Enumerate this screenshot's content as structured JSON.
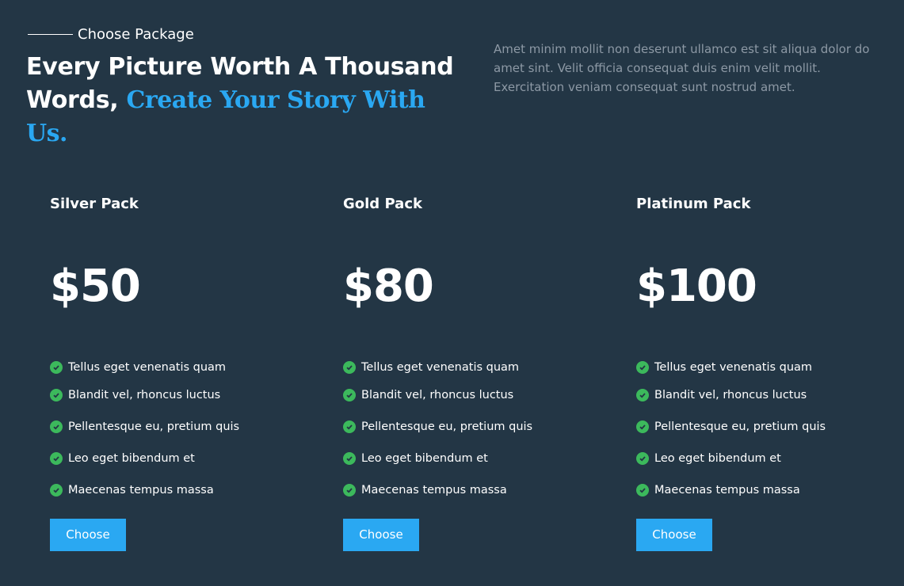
{
  "header": {
    "eyebrow": "Choose Package",
    "headline_plain": "Every Picture Worth A Thousand Words,",
    "headline_accent": "Create Your Story With Us.",
    "intro": "Amet minim mollit non deserunt ullamco est sit aliqua dolor do amet sint. Velit officia consequat duis enim velit mollit. Exercitation veniam consequat sunt nostrud amet."
  },
  "colors": {
    "background": "#233645",
    "accent": "#2aa8f2",
    "check": "#3cb95c",
    "muted_text": "#8d99a5"
  },
  "packages": [
    {
      "name": "Silver Pack",
      "price": "$50",
      "features": [
        "Tellus eget venenatis quam",
        "Blandit vel, rhoncus luctus",
        "Pellentesque eu, pretium quis",
        "Leo eget bibendum et",
        "Maecenas tempus massa"
      ],
      "button": "Choose"
    },
    {
      "name": "Gold Pack",
      "price": "$80",
      "features": [
        "Tellus eget venenatis quam",
        "Blandit vel, rhoncus luctus",
        "Pellentesque eu, pretium quis",
        "Leo eget bibendum et",
        "Maecenas tempus massa"
      ],
      "button": "Choose"
    },
    {
      "name": "Platinum Pack",
      "price": "$100",
      "features": [
        "Tellus eget venenatis quam",
        "Blandit vel, rhoncus luctus",
        "Pellentesque eu, pretium quis",
        "Leo eget bibendum et",
        "Maecenas tempus massa"
      ],
      "button": "Choose"
    }
  ],
  "icons": {
    "feature": "check-circle-icon"
  }
}
